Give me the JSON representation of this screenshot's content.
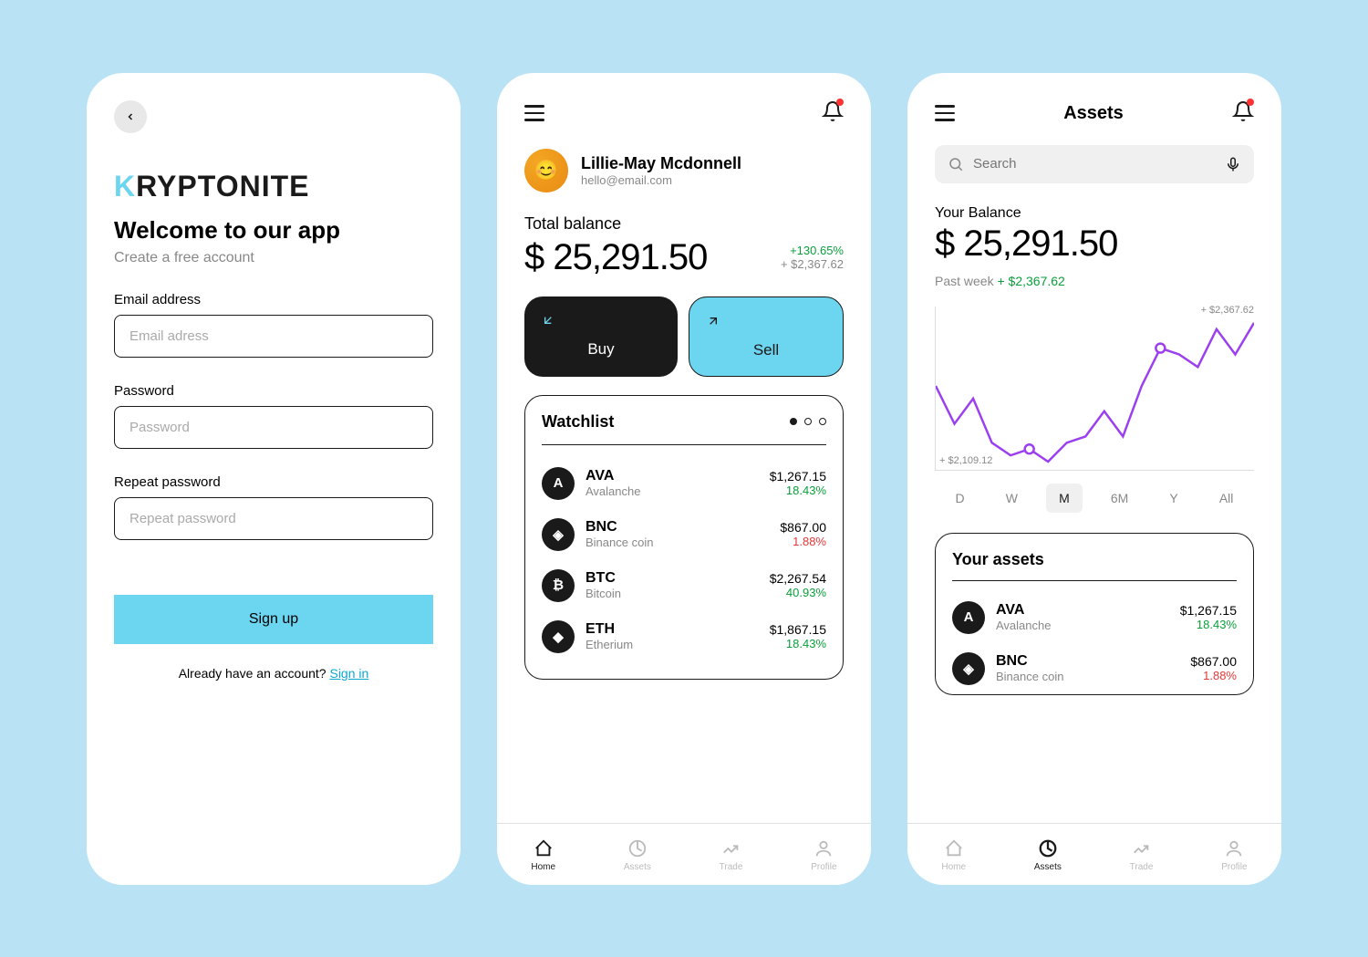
{
  "signup": {
    "logo_k": "K",
    "logo_rest": "RYPTONITE",
    "welcome_title": "Welcome to our app",
    "welcome_sub": "Create a free account",
    "email_label": "Email address",
    "email_placeholder": "Email adress",
    "password_label": "Password",
    "password_placeholder": "Password",
    "repeat_label": "Repeat password",
    "repeat_placeholder": "Repeat password",
    "signup_btn": "Sign up",
    "already_text": "Already have an account? ",
    "signin_link": "Sign in"
  },
  "home": {
    "user_name": "Lillie-May Mcdonnell",
    "user_email": "hello@email.com",
    "balance_label": "Total balance",
    "balance_amount": "$ 25,291.50",
    "balance_pct": "+130.65%",
    "balance_delta": "+ $2,367.62",
    "buy_label": "Buy",
    "sell_label": "Sell",
    "watchlist_title": "Watchlist",
    "coins": [
      {
        "sym": "AVA",
        "name": "Avalanche",
        "price": "$1,267.15",
        "change": "18.43%",
        "dir": "up",
        "letter": "A"
      },
      {
        "sym": "BNC",
        "name": "Binance coin",
        "price": "$867.00",
        "change": "1.88%",
        "dir": "down",
        "letter": "◈"
      },
      {
        "sym": "BTC",
        "name": "Bitcoin",
        "price": "$2,267.54",
        "change": "40.93%",
        "dir": "up",
        "letter": "₿"
      },
      {
        "sym": "ETH",
        "name": "Etherium",
        "price": "$1,867.15",
        "change": "18.43%",
        "dir": "up",
        "letter": "◆"
      }
    ]
  },
  "assets": {
    "page_title": "Assets",
    "search_placeholder": "Search",
    "balance_label": "Your Balance",
    "balance_amount": "$ 25,291.50",
    "past_week_label": "Past week ",
    "past_week_val": "+ $2,367.62",
    "chart_top": "+ $2,367.62",
    "chart_bot": "+ $2,109.12",
    "ranges": [
      "D",
      "W",
      "M",
      "6M",
      "Y",
      "All"
    ],
    "range_active": "M",
    "your_assets_title": "Your assets",
    "coins": [
      {
        "sym": "AVA",
        "name": "Avalanche",
        "price": "$1,267.15",
        "change": "18.43%",
        "dir": "up",
        "letter": "A"
      },
      {
        "sym": "BNC",
        "name": "Binance coin",
        "price": "$867.00",
        "change": "1.88%",
        "dir": "down",
        "letter": "◈"
      }
    ]
  },
  "nav": {
    "home": "Home",
    "assets": "Assets",
    "trade": "Trade",
    "profile": "Profile"
  },
  "chart_data": {
    "type": "line",
    "title": "",
    "xlabel": "",
    "ylabel": "",
    "ylim": [
      2109.12,
      2367.62
    ],
    "x": [
      0,
      1,
      2,
      3,
      4,
      5,
      6,
      7,
      8,
      9,
      10,
      11,
      12,
      13,
      14,
      15,
      16,
      17
    ],
    "values": [
      2250,
      2190,
      2230,
      2160,
      2140,
      2150,
      2130,
      2160,
      2170,
      2210,
      2170,
      2250,
      2310,
      2300,
      2280,
      2340,
      2300,
      2350
    ],
    "annotations": [
      "+ $2,367.62",
      "+ $2,109.12"
    ],
    "markers": [
      5,
      12
    ]
  }
}
